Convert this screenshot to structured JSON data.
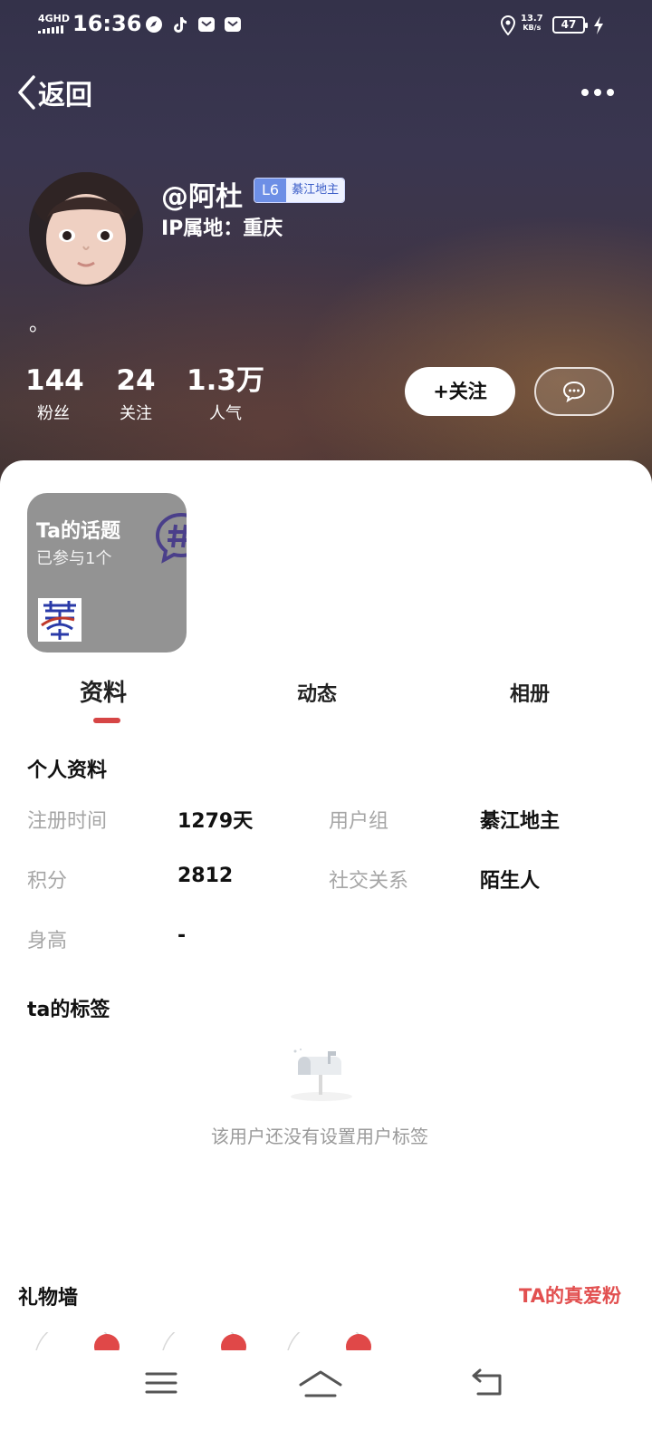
{
  "status_bar": {
    "network": "4GHD",
    "time": "16:36",
    "speed_value": "13.7",
    "speed_unit": "KB/s",
    "battery": "47"
  },
  "header": {
    "back_label": "返回"
  },
  "profile": {
    "username": "@阿杜",
    "level": "L6",
    "group_badge": "綦江地主",
    "ip_location": "IP属地：重庆",
    "bio": "。",
    "stats": [
      {
        "value": "144",
        "label": "粉丝"
      },
      {
        "value": "24",
        "label": "关注"
      },
      {
        "value": "1.3万",
        "label": "人气"
      }
    ],
    "follow_label": "+关注"
  },
  "topic_card": {
    "title": "Ta的话题",
    "subtitle": "已参与1个"
  },
  "tabs": [
    {
      "label": "资料",
      "active": true
    },
    {
      "label": "动态",
      "active": false
    },
    {
      "label": "相册",
      "active": false
    }
  ],
  "personal_info": {
    "title": "个人资料",
    "fields": [
      {
        "label": "注册时间",
        "value": "1279天"
      },
      {
        "label": "用户组",
        "value": "綦江地主"
      },
      {
        "label": "积分",
        "value": "2812"
      },
      {
        "label": "社交关系",
        "value": "陌生人"
      },
      {
        "label": "身高",
        "value": "-"
      }
    ]
  },
  "tags": {
    "title": "ta的标签",
    "empty_text": "该用户还没有设置用户标签"
  },
  "gift_wall": {
    "title": "礼物墙",
    "fans_link": "TA的真爱粉"
  },
  "colors": {
    "accent_red": "#d64545",
    "fans_red": "#e25050",
    "level_blue": "#6d8fe6",
    "label_gray": "#a6a6a6"
  }
}
